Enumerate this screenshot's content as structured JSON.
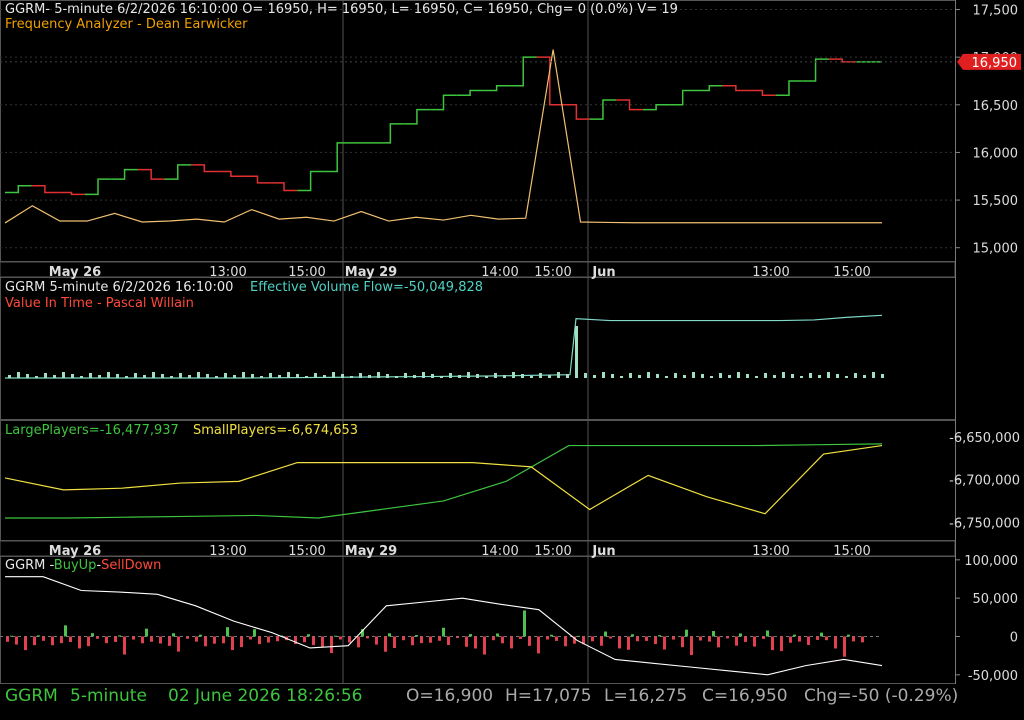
{
  "panels": {
    "price": {
      "line1": "GGRM- 5-minute 6/2/2026 16:10:00 O= 16950, H= 16950, L= 16950, C= 16950, Chg= 0 (0.0%) V= 19",
      "line2": "Frequency Analyzer - Dean Earwicker",
      "last_tag": "16,950",
      "y_ticks": [
        "17,500",
        "17,000",
        "16,500",
        "16,000",
        "15,500",
        "15,000"
      ]
    },
    "evf": {
      "line1_a": "GGRM 5-minute  6/2/2026 16:10:00",
      "line1_b": "Effective Volume Flow=-50,049,828",
      "line2": "Value In Time - Pascal Willain"
    },
    "players": {
      "large": "LargePlayers=-16,477,937",
      "small": "SmallPlayers=-6,674,653",
      "y_ticks": [
        "-6,650,000",
        "-6,700,000",
        "-6,750,000"
      ]
    },
    "buyup": {
      "sym": "GGRM",
      "dash1": "-",
      "buyup": "BuyUp",
      "dash2": "-",
      "selldown": "SellDown",
      "y_ticks": [
        "100,000",
        "50,000",
        "0",
        "-50,000"
      ]
    }
  },
  "x_axis": [
    "May 26",
    "13:00",
    "15:00",
    "May 29",
    "14:00",
    "15:00",
    "Jun",
    "13:00",
    "15:00"
  ],
  "status_bar": {
    "symbol": "GGRM",
    "interval": "5-minute",
    "datetime": "02 June 2026 18:26:56",
    "open": "O=16,900",
    "high": "H=17,075",
    "low": "L=16,275",
    "close": "C=16,950",
    "change": "Chg=-50 (-0.29%)"
  },
  "colors": {
    "up": "#3ec43e",
    "down": "#e03030",
    "frequency": "#f0c070",
    "evf": "#7fd8c8",
    "large": "#3ec43e",
    "small": "#f0e040",
    "flow": "#ffffff",
    "tag": "#e02020"
  },
  "chart_data": [
    {
      "type": "line",
      "title": "GGRM- 5-minute 6/2/2026 16:10:00",
      "categories": [
        "May 26",
        "13:00",
        "15:00",
        "May 29",
        "14:00",
        "15:00",
        "Jun",
        "13:00",
        "15:00"
      ],
      "ylim": [
        14850,
        17600
      ],
      "series": [
        {
          "name": "Price",
          "values": [
            15580,
            15650,
            15580,
            15560,
            15720,
            15820,
            15720,
            15870,
            15800,
            15750,
            15680,
            15600,
            15800,
            16100,
            16100,
            16300,
            16450,
            16600,
            16650,
            16700,
            17000,
            16500,
            16350,
            16550,
            16450,
            16500,
            16650,
            16700,
            16650,
            16600,
            16750,
            16980,
            16950,
            16950
          ]
        },
        {
          "name": "Frequency Analyzer",
          "values": [
            15260,
            15440,
            15280,
            15280,
            15360,
            15270,
            15280,
            15300,
            15270,
            15400,
            15300,
            15320,
            15280,
            15380,
            15280,
            15320,
            15290,
            15340,
            15300,
            15310,
            17080,
            15270,
            15265,
            15262,
            15262,
            15262,
            15262,
            15262,
            15262,
            15262,
            15262,
            15262,
            15262
          ]
        }
      ]
    },
    {
      "type": "line",
      "title": "Effective Volume Flow=-50,049,828",
      "series": [
        {
          "name": "Effective Volume Flow",
          "values": [
            0,
            0,
            0,
            0,
            0.01,
            0.02,
            0.03,
            0.05,
            0.9,
            0.87,
            0.87,
            0.87,
            0.87,
            0.87,
            0.87,
            0.88,
            0.92,
            0.95
          ]
        }
      ]
    },
    {
      "type": "line",
      "title": "LargePlayers / SmallPlayers",
      "ylim": [
        -6772000,
        -6630000
      ],
      "series": [
        {
          "name": "LargePlayers",
          "values": [
            -6745000,
            -6745000,
            -6744000,
            -6743000,
            -6742000,
            -6745000,
            -6735000,
            -6725000,
            -6702000,
            -6660000,
            -6660000,
            -6660000,
            -6660000,
            -6659000,
            -6658000
          ]
        },
        {
          "name": "SmallPlayers",
          "values": [
            -6698000,
            -6712000,
            -6710000,
            -6704000,
            -6702000,
            -6680000,
            -6680000,
            -6680000,
            -6680000,
            -6685000,
            -6735000,
            -6695000,
            -6720000,
            -6740000,
            -6670000,
            -6660000
          ]
        }
      ]
    },
    {
      "type": "bar",
      "title": "GGRM - BuyUp-SellDown",
      "ylim": [
        -62000,
        105000
      ],
      "series": [
        {
          "name": "BuyUp",
          "values": [
            8000,
            12000,
            5000,
            9000,
            6000,
            40000,
            72000,
            28000,
            15000,
            18000,
            20000,
            6000,
            5000,
            10000,
            32000,
            32000,
            18000
          ]
        },
        {
          "name": "SellDown",
          "values": [
            -28000,
            -22000,
            -25000,
            -12000,
            -14000,
            -18000,
            -10000,
            -22000,
            -28000,
            -16000,
            -12000,
            -18000,
            -10000,
            -25000,
            -10000,
            -14000,
            -8000
          ]
        },
        {
          "name": "Flow",
          "values": [
            78000,
            78000,
            60000,
            58000,
            55000,
            40000,
            20000,
            5000,
            -15000,
            -12000,
            40000,
            45000,
            50000,
            42000,
            35000,
            -5000,
            -30000,
            -35000,
            -40000,
            -45000,
            -50000,
            -38000,
            -30000,
            -38000
          ]
        }
      ]
    }
  ]
}
